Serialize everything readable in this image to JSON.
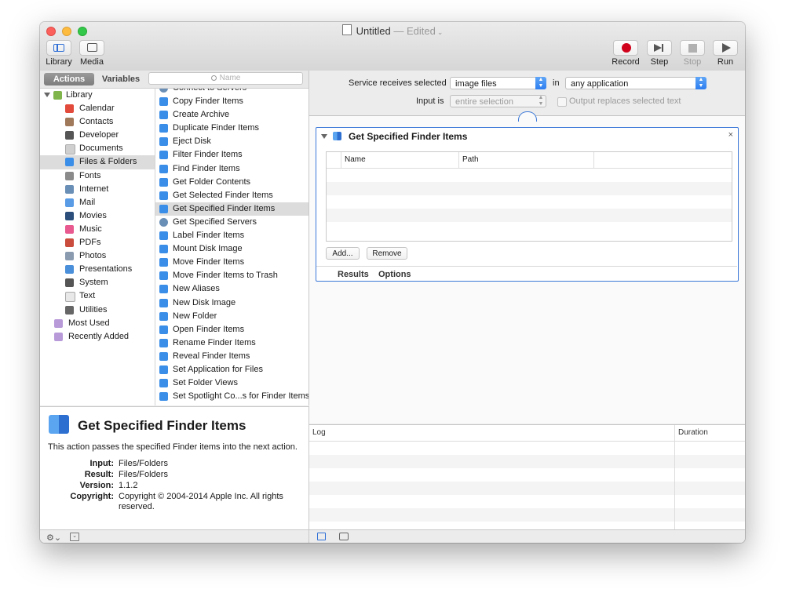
{
  "window": {
    "title": "Untitled",
    "title_suffix": "— Edited",
    "title_chevron": "⌄"
  },
  "toolbar": {
    "library_label": "Library",
    "media_label": "Media",
    "record_label": "Record",
    "step_label": "Step",
    "stop_label": "Stop",
    "run_label": "Run"
  },
  "library": {
    "tabs": {
      "actions": "Actions",
      "variables": "Variables"
    },
    "search_placeholder": "Name",
    "categories": [
      {
        "label": "Library",
        "icon": "library-icon",
        "color": "#7fb54a"
      },
      {
        "label": "Calendar",
        "icon": "calendar-icon",
        "color": "#e24b3b"
      },
      {
        "label": "Contacts",
        "icon": "contacts-icon",
        "color": "#a0785a"
      },
      {
        "label": "Developer",
        "icon": "developer-icon",
        "color": "#555555"
      },
      {
        "label": "Documents",
        "icon": "documents-icon",
        "color": "#cfcfcf"
      },
      {
        "label": "Files & Folders",
        "icon": "finder-icon",
        "color": "#3b8ee8"
      },
      {
        "label": "Fonts",
        "icon": "fonts-icon",
        "color": "#8a8a8a"
      },
      {
        "label": "Internet",
        "icon": "internet-icon",
        "color": "#6a8fb6"
      },
      {
        "label": "Mail",
        "icon": "mail-icon",
        "color": "#5a9be6"
      },
      {
        "label": "Movies",
        "icon": "movies-icon",
        "color": "#2b4f7a"
      },
      {
        "label": "Music",
        "icon": "music-icon",
        "color": "#e85a8f"
      },
      {
        "label": "PDFs",
        "icon": "pdfs-icon",
        "color": "#c94c3c"
      },
      {
        "label": "Photos",
        "icon": "photos-icon",
        "color": "#8a9bb0"
      },
      {
        "label": "Presentations",
        "icon": "presentations-icon",
        "color": "#4a8fd9"
      },
      {
        "label": "System",
        "icon": "system-icon",
        "color": "#555555"
      },
      {
        "label": "Text",
        "icon": "text-icon",
        "color": "#e8e8e8"
      },
      {
        "label": "Utilities",
        "icon": "utilities-icon",
        "color": "#666666"
      },
      {
        "label": "Most Used",
        "icon": "smart-folder-icon",
        "color": "#b89ad9"
      },
      {
        "label": "Recently Added",
        "icon": "smart-folder-icon",
        "color": "#b89ad9"
      }
    ],
    "selected_category": "Files & Folders",
    "actions": [
      {
        "label": "Connect to Servers",
        "icon": "globe-icon"
      },
      {
        "label": "Copy Finder Items",
        "icon": "finder-icon"
      },
      {
        "label": "Create Archive",
        "icon": "finder-icon"
      },
      {
        "label": "Duplicate Finder Items",
        "icon": "finder-icon"
      },
      {
        "label": "Eject Disk",
        "icon": "finder-icon"
      },
      {
        "label": "Filter Finder Items",
        "icon": "finder-icon"
      },
      {
        "label": "Find Finder Items",
        "icon": "finder-icon"
      },
      {
        "label": "Get Folder Contents",
        "icon": "finder-icon"
      },
      {
        "label": "Get Selected Finder Items",
        "icon": "finder-icon"
      },
      {
        "label": "Get Specified Finder Items",
        "icon": "finder-icon"
      },
      {
        "label": "Get Specified Servers",
        "icon": "globe-icon"
      },
      {
        "label": "Label Finder Items",
        "icon": "finder-icon"
      },
      {
        "label": "Mount Disk Image",
        "icon": "finder-icon"
      },
      {
        "label": "Move Finder Items",
        "icon": "finder-icon"
      },
      {
        "label": "Move Finder Items to Trash",
        "icon": "finder-icon"
      },
      {
        "label": "New Aliases",
        "icon": "finder-icon"
      },
      {
        "label": "New Disk Image",
        "icon": "finder-icon"
      },
      {
        "label": "New Folder",
        "icon": "finder-icon"
      },
      {
        "label": "Open Finder Items",
        "icon": "finder-icon"
      },
      {
        "label": "Rename Finder Items",
        "icon": "finder-icon"
      },
      {
        "label": "Reveal Finder Items",
        "icon": "finder-icon"
      },
      {
        "label": "Set Application for Files",
        "icon": "finder-icon"
      },
      {
        "label": "Set Folder Views",
        "icon": "finder-icon"
      },
      {
        "label": "Set Spotlight Co...s for Finder Items",
        "icon": "finder-icon"
      }
    ],
    "selected_action": "Get Specified Finder Items"
  },
  "description": {
    "title": "Get Specified Finder Items",
    "text": "This action passes the specified Finder items into the next action.",
    "input_key": "Input:",
    "input_val": "Files/Folders",
    "result_key": "Result:",
    "result_val": "Files/Folders",
    "version_key": "Version:",
    "version_val": "1.1.2",
    "copyright_key": "Copyright:",
    "copyright_val": "Copyright © 2004-2014 Apple Inc.  All rights reserved."
  },
  "service": {
    "receives_label": "Service receives selected",
    "receives_value": "image files",
    "in_label": "in",
    "app_value": "any application",
    "input_is_label": "Input is",
    "input_is_value": "entire selection",
    "output_label": "Output replaces selected text"
  },
  "action_box": {
    "title": "Get Specified Finder Items",
    "close": "×",
    "col_name": "Name",
    "col_path": "Path",
    "add_label": "Add...",
    "remove_label": "Remove",
    "tab_results": "Results",
    "tab_options": "Options"
  },
  "log": {
    "col_log": "Log",
    "col_duration": "Duration"
  },
  "colors": {
    "accent": "#3a78d8",
    "record": "#d0021b"
  }
}
